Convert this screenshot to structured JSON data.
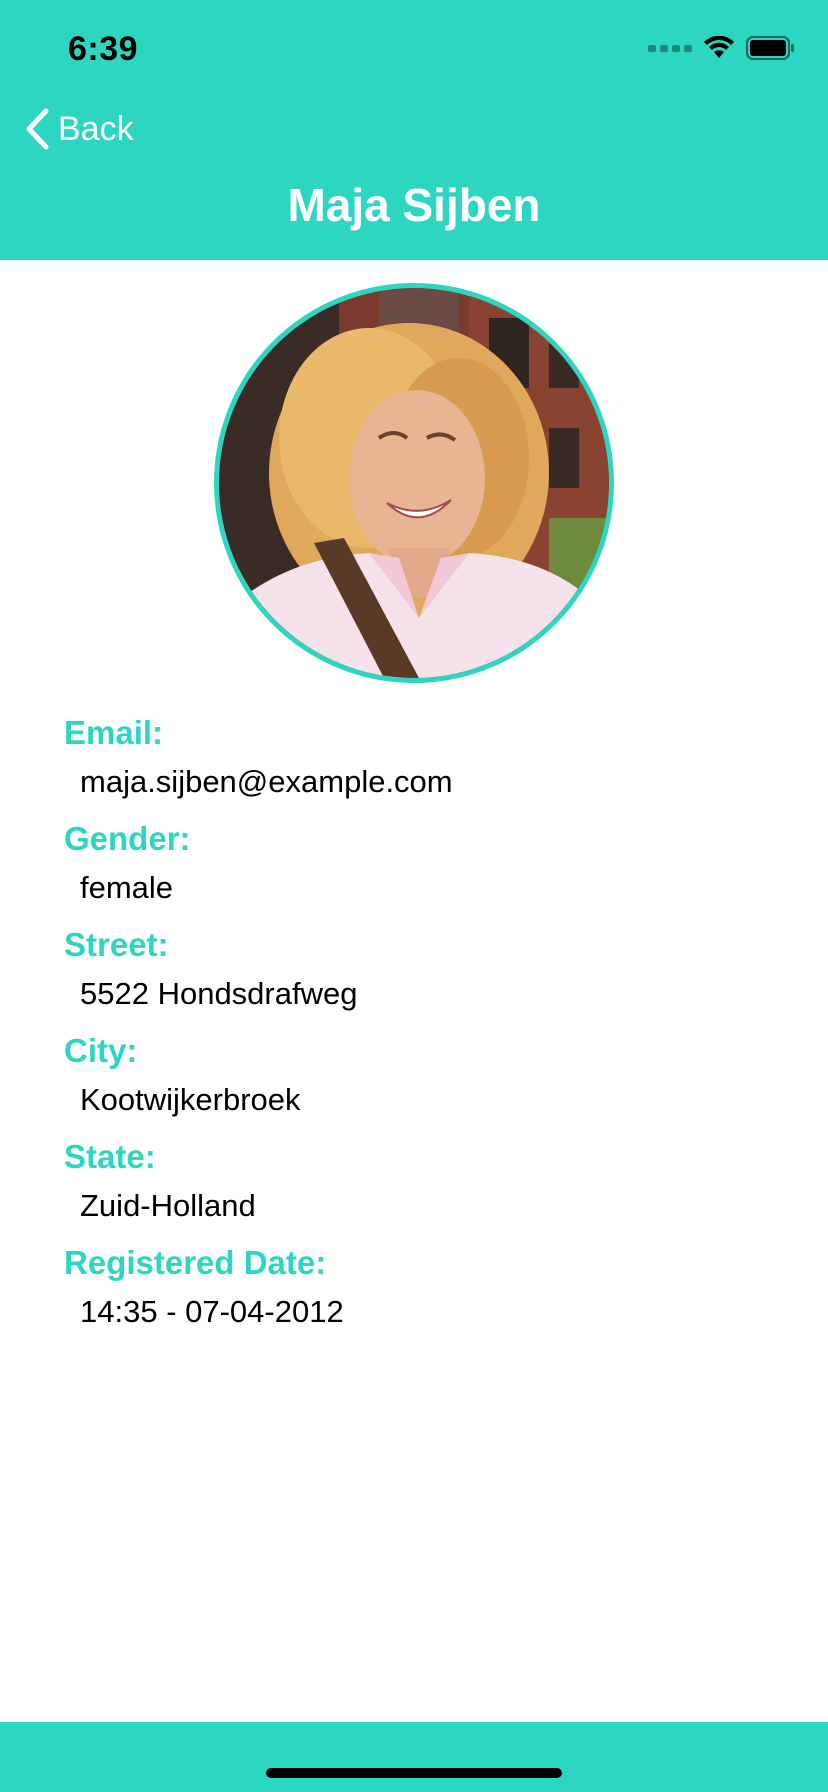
{
  "status_bar": {
    "time": "6:39"
  },
  "nav": {
    "back_label": "Back",
    "title": "Maja Sijben"
  },
  "colors": {
    "accent": "#2cd6c0",
    "text": "#000000",
    "background": "#ffffff"
  },
  "profile": {
    "fields": [
      {
        "label": "Email:",
        "value": "maja.sijben@example.com"
      },
      {
        "label": "Gender:",
        "value": "female"
      },
      {
        "label": "Street:",
        "value": "5522 Hondsdrafweg"
      },
      {
        "label": "City:",
        "value": "Kootwijkerbroek"
      },
      {
        "label": "State:",
        "value": "Zuid-Holland"
      },
      {
        "label": "Registered Date:",
        "value": "14:35 - 07-04-2012"
      }
    ]
  },
  "icons": {
    "back": "chevron-left-icon",
    "wifi": "wifi-icon",
    "battery": "battery-icon",
    "signal": "cellular-signal-icon"
  }
}
